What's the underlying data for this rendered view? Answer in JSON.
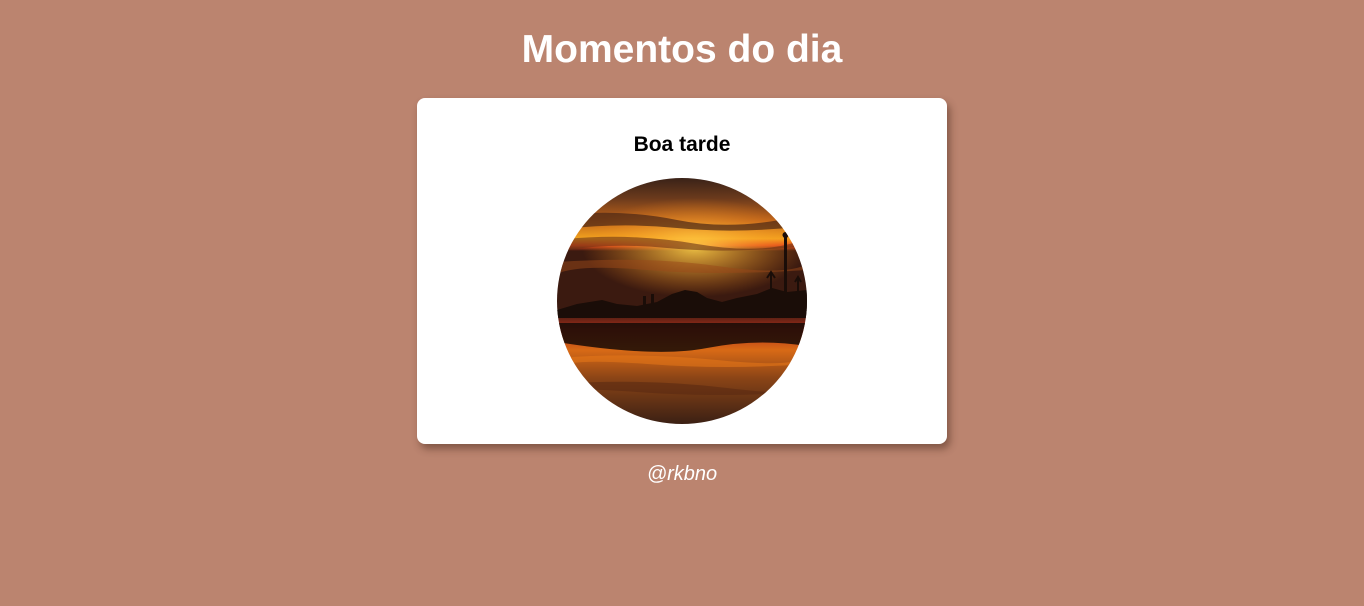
{
  "page": {
    "title": "Momentos do dia",
    "background_color": "#bb846f"
  },
  "card": {
    "greeting": "Boa tarde",
    "image_subject": "sunset-beach-reflection"
  },
  "footer": {
    "credit": "@rkbno"
  }
}
